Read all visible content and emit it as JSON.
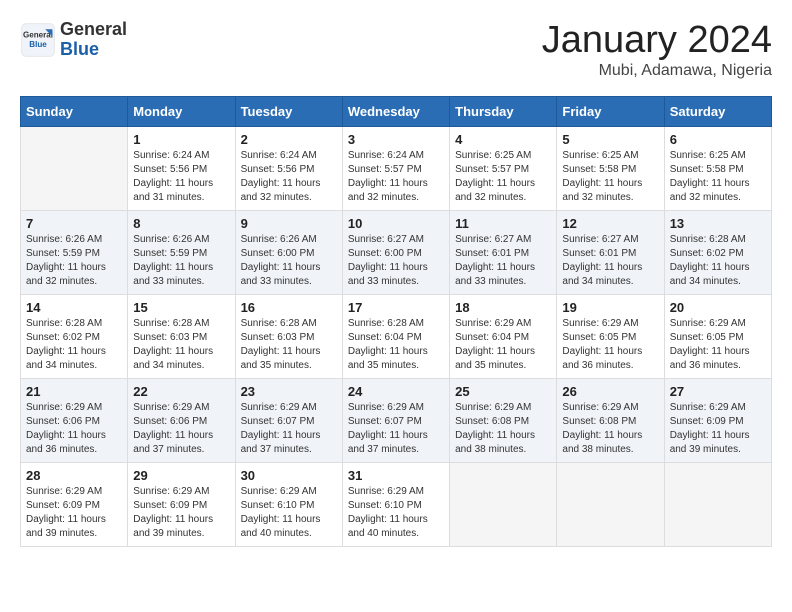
{
  "header": {
    "logo_line1": "General",
    "logo_line2": "Blue",
    "month_title": "January 2024",
    "location": "Mubi, Adamawa, Nigeria"
  },
  "days_of_week": [
    "Sunday",
    "Monday",
    "Tuesday",
    "Wednesday",
    "Thursday",
    "Friday",
    "Saturday"
  ],
  "weeks": [
    [
      {
        "num": "",
        "sunrise": "",
        "sunset": "",
        "daylight": ""
      },
      {
        "num": "1",
        "sunrise": "Sunrise: 6:24 AM",
        "sunset": "Sunset: 5:56 PM",
        "daylight": "Daylight: 11 hours and 31 minutes."
      },
      {
        "num": "2",
        "sunrise": "Sunrise: 6:24 AM",
        "sunset": "Sunset: 5:56 PM",
        "daylight": "Daylight: 11 hours and 32 minutes."
      },
      {
        "num": "3",
        "sunrise": "Sunrise: 6:24 AM",
        "sunset": "Sunset: 5:57 PM",
        "daylight": "Daylight: 11 hours and 32 minutes."
      },
      {
        "num": "4",
        "sunrise": "Sunrise: 6:25 AM",
        "sunset": "Sunset: 5:57 PM",
        "daylight": "Daylight: 11 hours and 32 minutes."
      },
      {
        "num": "5",
        "sunrise": "Sunrise: 6:25 AM",
        "sunset": "Sunset: 5:58 PM",
        "daylight": "Daylight: 11 hours and 32 minutes."
      },
      {
        "num": "6",
        "sunrise": "Sunrise: 6:25 AM",
        "sunset": "Sunset: 5:58 PM",
        "daylight": "Daylight: 11 hours and 32 minutes."
      }
    ],
    [
      {
        "num": "7",
        "sunrise": "Sunrise: 6:26 AM",
        "sunset": "Sunset: 5:59 PM",
        "daylight": "Daylight: 11 hours and 32 minutes."
      },
      {
        "num": "8",
        "sunrise": "Sunrise: 6:26 AM",
        "sunset": "Sunset: 5:59 PM",
        "daylight": "Daylight: 11 hours and 33 minutes."
      },
      {
        "num": "9",
        "sunrise": "Sunrise: 6:26 AM",
        "sunset": "Sunset: 6:00 PM",
        "daylight": "Daylight: 11 hours and 33 minutes."
      },
      {
        "num": "10",
        "sunrise": "Sunrise: 6:27 AM",
        "sunset": "Sunset: 6:00 PM",
        "daylight": "Daylight: 11 hours and 33 minutes."
      },
      {
        "num": "11",
        "sunrise": "Sunrise: 6:27 AM",
        "sunset": "Sunset: 6:01 PM",
        "daylight": "Daylight: 11 hours and 33 minutes."
      },
      {
        "num": "12",
        "sunrise": "Sunrise: 6:27 AM",
        "sunset": "Sunset: 6:01 PM",
        "daylight": "Daylight: 11 hours and 34 minutes."
      },
      {
        "num": "13",
        "sunrise": "Sunrise: 6:28 AM",
        "sunset": "Sunset: 6:02 PM",
        "daylight": "Daylight: 11 hours and 34 minutes."
      }
    ],
    [
      {
        "num": "14",
        "sunrise": "Sunrise: 6:28 AM",
        "sunset": "Sunset: 6:02 PM",
        "daylight": "Daylight: 11 hours and 34 minutes."
      },
      {
        "num": "15",
        "sunrise": "Sunrise: 6:28 AM",
        "sunset": "Sunset: 6:03 PM",
        "daylight": "Daylight: 11 hours and 34 minutes."
      },
      {
        "num": "16",
        "sunrise": "Sunrise: 6:28 AM",
        "sunset": "Sunset: 6:03 PM",
        "daylight": "Daylight: 11 hours and 35 minutes."
      },
      {
        "num": "17",
        "sunrise": "Sunrise: 6:28 AM",
        "sunset": "Sunset: 6:04 PM",
        "daylight": "Daylight: 11 hours and 35 minutes."
      },
      {
        "num": "18",
        "sunrise": "Sunrise: 6:29 AM",
        "sunset": "Sunset: 6:04 PM",
        "daylight": "Daylight: 11 hours and 35 minutes."
      },
      {
        "num": "19",
        "sunrise": "Sunrise: 6:29 AM",
        "sunset": "Sunset: 6:05 PM",
        "daylight": "Daylight: 11 hours and 36 minutes."
      },
      {
        "num": "20",
        "sunrise": "Sunrise: 6:29 AM",
        "sunset": "Sunset: 6:05 PM",
        "daylight": "Daylight: 11 hours and 36 minutes."
      }
    ],
    [
      {
        "num": "21",
        "sunrise": "Sunrise: 6:29 AM",
        "sunset": "Sunset: 6:06 PM",
        "daylight": "Daylight: 11 hours and 36 minutes."
      },
      {
        "num": "22",
        "sunrise": "Sunrise: 6:29 AM",
        "sunset": "Sunset: 6:06 PM",
        "daylight": "Daylight: 11 hours and 37 minutes."
      },
      {
        "num": "23",
        "sunrise": "Sunrise: 6:29 AM",
        "sunset": "Sunset: 6:07 PM",
        "daylight": "Daylight: 11 hours and 37 minutes."
      },
      {
        "num": "24",
        "sunrise": "Sunrise: 6:29 AM",
        "sunset": "Sunset: 6:07 PM",
        "daylight": "Daylight: 11 hours and 37 minutes."
      },
      {
        "num": "25",
        "sunrise": "Sunrise: 6:29 AM",
        "sunset": "Sunset: 6:08 PM",
        "daylight": "Daylight: 11 hours and 38 minutes."
      },
      {
        "num": "26",
        "sunrise": "Sunrise: 6:29 AM",
        "sunset": "Sunset: 6:08 PM",
        "daylight": "Daylight: 11 hours and 38 minutes."
      },
      {
        "num": "27",
        "sunrise": "Sunrise: 6:29 AM",
        "sunset": "Sunset: 6:09 PM",
        "daylight": "Daylight: 11 hours and 39 minutes."
      }
    ],
    [
      {
        "num": "28",
        "sunrise": "Sunrise: 6:29 AM",
        "sunset": "Sunset: 6:09 PM",
        "daylight": "Daylight: 11 hours and 39 minutes."
      },
      {
        "num": "29",
        "sunrise": "Sunrise: 6:29 AM",
        "sunset": "Sunset: 6:09 PM",
        "daylight": "Daylight: 11 hours and 39 minutes."
      },
      {
        "num": "30",
        "sunrise": "Sunrise: 6:29 AM",
        "sunset": "Sunset: 6:10 PM",
        "daylight": "Daylight: 11 hours and 40 minutes."
      },
      {
        "num": "31",
        "sunrise": "Sunrise: 6:29 AM",
        "sunset": "Sunset: 6:10 PM",
        "daylight": "Daylight: 11 hours and 40 minutes."
      },
      {
        "num": "",
        "sunrise": "",
        "sunset": "",
        "daylight": ""
      },
      {
        "num": "",
        "sunrise": "",
        "sunset": "",
        "daylight": ""
      },
      {
        "num": "",
        "sunrise": "",
        "sunset": "",
        "daylight": ""
      }
    ]
  ]
}
